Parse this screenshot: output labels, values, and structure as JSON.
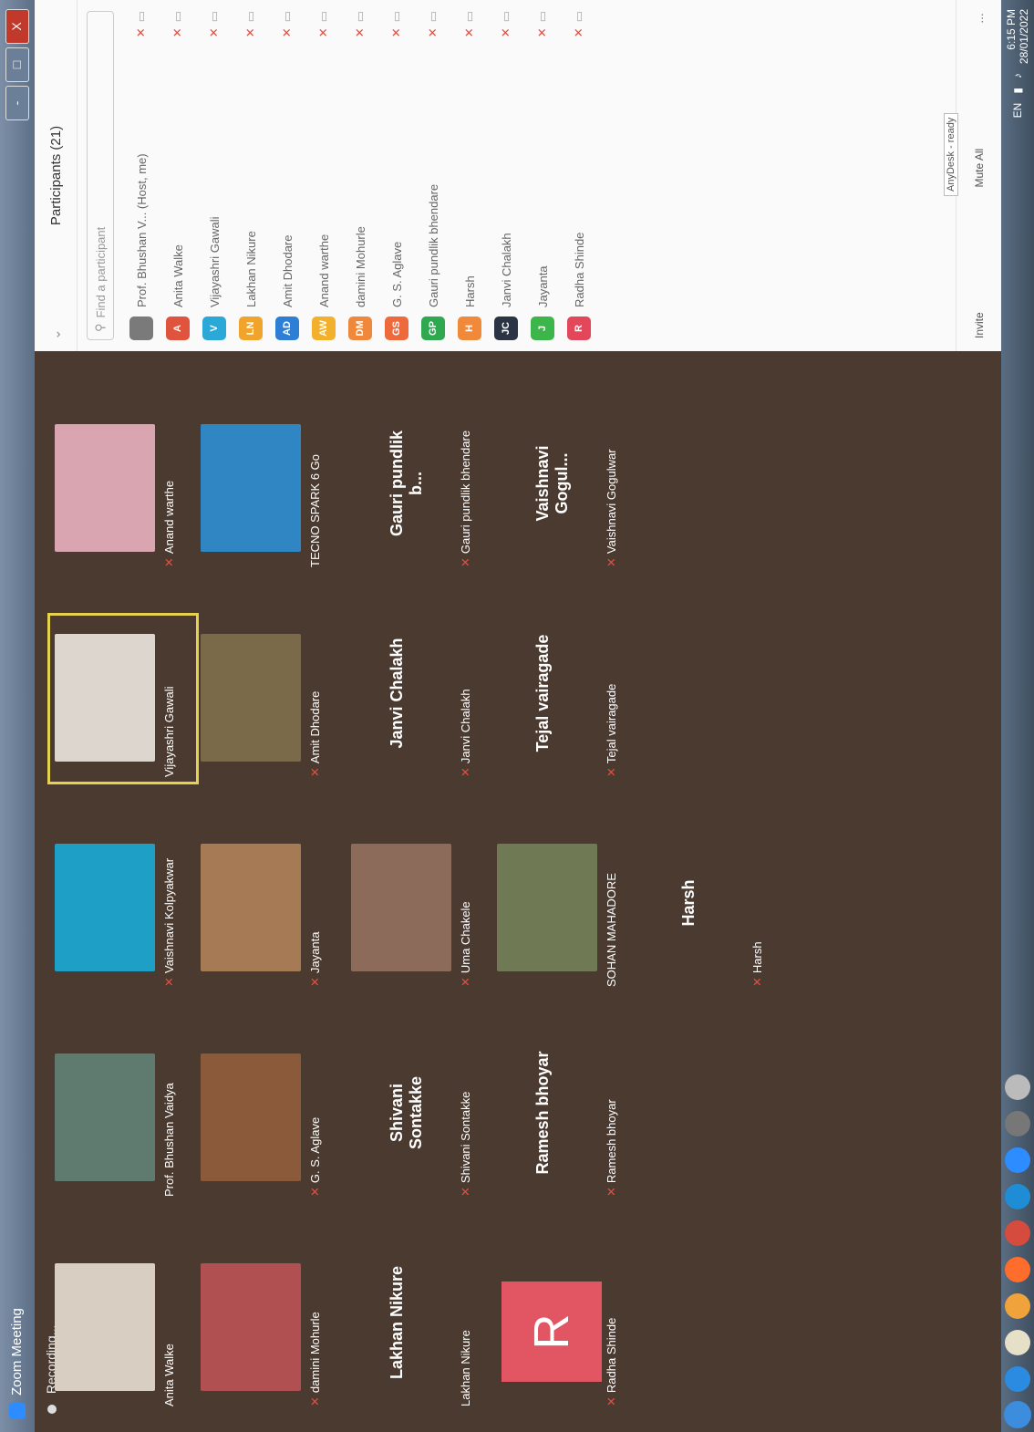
{
  "window": {
    "title": "Zoom Meeting",
    "controls": [
      "-",
      "□",
      "X"
    ]
  },
  "recording": {
    "label": "Recording..."
  },
  "gallery": {
    "tiles": [
      {
        "label": "Anita Walke",
        "muted": false,
        "type": "video",
        "color": "#d8cfc2"
      },
      {
        "label": "damini Mohurle",
        "muted": true,
        "type": "video",
        "color": "#b05050"
      },
      {
        "label": "Lakhan Nikure",
        "muted": false,
        "type": "name",
        "display": "Lakhan Nikure"
      },
      {
        "label": "Radha Shinde",
        "muted": true,
        "type": "avatar",
        "display": "R"
      },
      {
        "label": "Prof. Bhushan Vaidya",
        "muted": false,
        "type": "video",
        "color": "#5f7a6f"
      },
      {
        "label": "G. S. Aglave",
        "muted": true,
        "type": "video",
        "color": "#8a5a3a"
      },
      {
        "label": "Shivani Sontakke",
        "muted": true,
        "type": "name",
        "display": "Shivani Sontakke"
      },
      {
        "label": "Ramesh bhoyar",
        "muted": true,
        "type": "name",
        "display": "Ramesh bhoyar"
      },
      {
        "label": "Vaishnavi Kolpyakwar",
        "muted": true,
        "type": "video",
        "color": "#1e9fc6"
      },
      {
        "label": "Jayanta",
        "muted": true,
        "type": "video",
        "color": "#a57a55"
      },
      {
        "label": "Uma Chakele",
        "muted": true,
        "type": "video",
        "color": "#8d6b5a"
      },
      {
        "label": "SOHAN MAHADORE",
        "muted": false,
        "type": "video",
        "color": "#6f7a55"
      },
      {
        "label": "Harsh",
        "muted": true,
        "type": "name",
        "display": "Harsh"
      },
      {
        "label": "Vijayashri Gawali",
        "muted": false,
        "type": "video",
        "color": "#dcd6cf",
        "active": true
      },
      {
        "label": "Amit Dhodare",
        "muted": true,
        "type": "video",
        "color": "#7a6a4a"
      },
      {
        "label": "Janvi Chalakh",
        "muted": true,
        "type": "name",
        "display": "Janvi Chalakh"
      },
      {
        "label": "Tejal vairagade",
        "muted": true,
        "type": "name",
        "display": "Tejal vairagade"
      },
      {
        "label": "Anand warthe",
        "muted": true,
        "type": "video",
        "color": "#d9a5b0"
      },
      {
        "label": "TECNO SPARK 6 Go",
        "muted": false,
        "type": "video",
        "color": "#2f86c2"
      },
      {
        "label": "Gauri pundlik bhendare",
        "muted": true,
        "type": "name",
        "display": "Gauri pundlik b..."
      },
      {
        "label": "Vaishnavi Gogulwar",
        "muted": true,
        "type": "name",
        "display": "Vaishnavi Gogul..."
      }
    ]
  },
  "participants": {
    "title": "Participants (21)",
    "search_placeholder": "Find a participant",
    "list": [
      {
        "initials": "",
        "name": "Prof. Bhushan V... (Host, me)",
        "color": "#7a7a7a"
      },
      {
        "initials": "A",
        "name": "Anita Walke",
        "color": "#e0533c"
      },
      {
        "initials": "V",
        "name": "Vijayashri Gawali",
        "color": "#2aa8d8"
      },
      {
        "initials": "LN",
        "name": "Lakhan Nikure",
        "color": "#f0a42b"
      },
      {
        "initials": "AD",
        "name": "Amit Dhodare",
        "color": "#2d7fd6"
      },
      {
        "initials": "AW",
        "name": "Anand warthe",
        "color": "#f2b02d"
      },
      {
        "initials": "DM",
        "name": "damini Mohurle",
        "color": "#f0883c"
      },
      {
        "initials": "GS",
        "name": "G. S. Aglave",
        "color": "#ee6a3c"
      },
      {
        "initials": "GP",
        "name": "Gauri pundlik bhendare",
        "color": "#2fa84f"
      },
      {
        "initials": "H",
        "name": "Harsh",
        "color": "#f08a3a"
      },
      {
        "initials": "JC",
        "name": "Janvi Chalakh",
        "color": "#2b3445"
      },
      {
        "initials": "J",
        "name": "Jayanta",
        "color": "#3cb54a"
      },
      {
        "initials": "R",
        "name": "Radha Shinde",
        "color": "#e2475a"
      }
    ],
    "footer": {
      "invite": "Invite",
      "mute_all": "Mute All",
      "tooltip": "AnyDesk - ready"
    }
  },
  "taskbar": {
    "language": "EN",
    "time": "6:15 PM",
    "date": "28/01/2022"
  }
}
